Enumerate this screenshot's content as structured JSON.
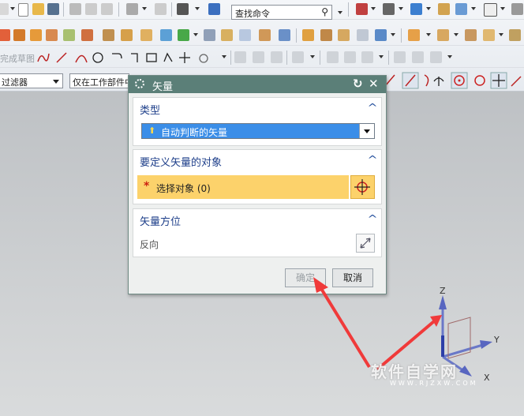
{
  "toolbar": {
    "search_placeholder": "查找命令",
    "sketch_label": "完成草图",
    "filter_label": "过滤器",
    "scope_label": "仅在工作部件中"
  },
  "dialog": {
    "title": "矢量",
    "sections": {
      "type": {
        "title": "类型",
        "selected": "自动判断的矢量"
      },
      "object": {
        "title": "要定义矢量的对象",
        "select_label": "选择对象 (0)",
        "required_mark": "*"
      },
      "orientation": {
        "title": "矢量方位",
        "reverse_label": "反向"
      }
    },
    "ok_label": "确定",
    "cancel_label": "取消"
  },
  "axes": {
    "x": "X",
    "y": "Y",
    "z": "Z"
  },
  "watermark": {
    "text": "软件自学网",
    "url": "WWW.RJZXW.COM"
  },
  "colors": {
    "title_bar": "#5b7f78",
    "selected_type": "#3b8ee8",
    "required_row": "#fcd26b",
    "arrow": "#f03a3a"
  }
}
